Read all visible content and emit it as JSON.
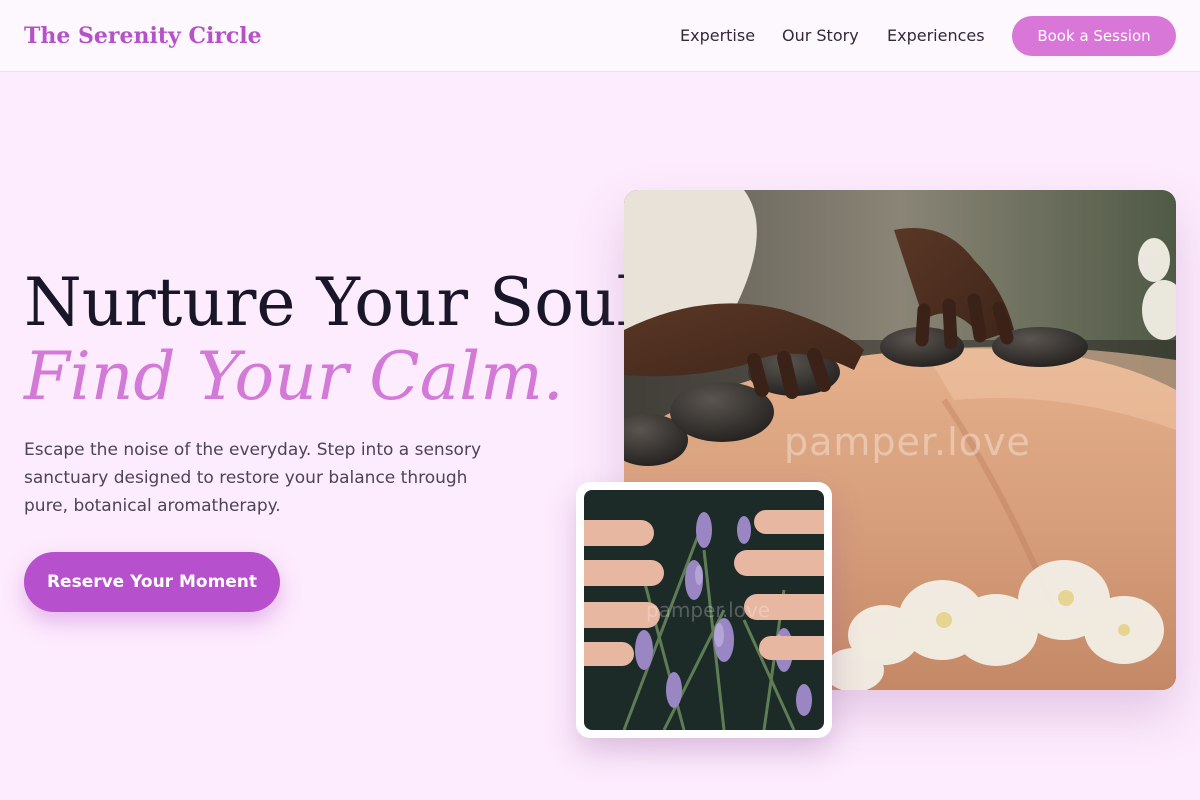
{
  "header": {
    "brand": "The Serenity Circle",
    "nav": {
      "expertise": "Expertise",
      "story": "Our Story",
      "experiences": "Experiences"
    },
    "cta": "Book a Session"
  },
  "hero": {
    "title_line1": "Nurture Your Soul,",
    "title_line2": "Find Your Calm.",
    "description": "Escape the noise of the everyday. Step into a sensory sanctuary designed to restore your balance through pure, botanical aromatherapy.",
    "cta": "Reserve Your Moment"
  },
  "images": {
    "main_watermark": "pamper.love",
    "inset_watermark": "pamper.love"
  },
  "colors": {
    "brand": "#b652c7",
    "accent": "#d37ad8",
    "button_primary": "#b650cd",
    "button_header": "#d877d8",
    "background": "#fdecfd"
  },
  "icons": {
    "main_photo": "hot-stone-massage-photo",
    "inset_photo": "lavender-hands-photo"
  }
}
